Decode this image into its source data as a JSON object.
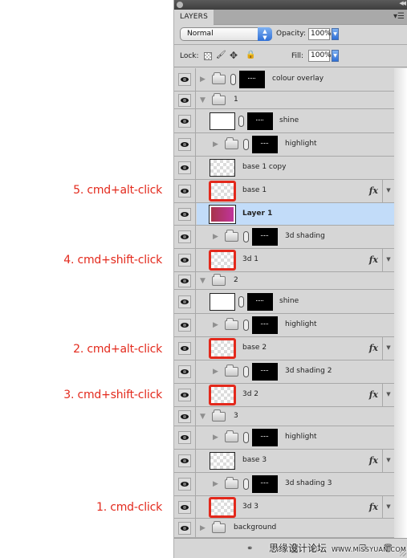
{
  "annotations": [
    {
      "label": "5. cmd+alt-click",
      "target": "base 1"
    },
    {
      "label": "4. cmd+shift-click",
      "target": "3d 1"
    },
    {
      "label": "2. cmd+alt-click",
      "target": "base 2"
    },
    {
      "label": "3. cmd+shift-click",
      "target": "3d 2"
    },
    {
      "label": "1. cmd-click",
      "target": "3d 3"
    }
  ],
  "panel": {
    "tab_label": "LAYERS",
    "collapse_icon": "double-arrow-icon",
    "menu_icon": "panel-menu-icon",
    "blend_mode": "Normal",
    "opacity_label": "Opacity:",
    "opacity_value": "100%",
    "lock_label": "Lock:",
    "fill_label": "Fill:",
    "fill_value": "100%",
    "lock_icons": [
      "lock-transparency-icon",
      "lock-paint-icon",
      "lock-move-icon",
      "lock-all-icon"
    ]
  },
  "layers": [
    {
      "name": "colour overlay",
      "type": "group",
      "expanded": false,
      "mask": true,
      "indent": 0
    },
    {
      "name": "1",
      "type": "group",
      "expanded": true,
      "mask": false,
      "indent": 0
    },
    {
      "name": "shine",
      "type": "layer",
      "mask": true,
      "indent": 1
    },
    {
      "name": "highlight",
      "type": "group",
      "expanded": false,
      "mask": true,
      "indent": 1
    },
    {
      "name": "base 1 copy",
      "type": "layer",
      "indent": 1
    },
    {
      "name": "base 1",
      "type": "layer",
      "indent": 1,
      "fx": true,
      "highlighted_thumb": true
    },
    {
      "name": "Layer 1",
      "type": "layer",
      "indent": 1,
      "selected": true
    },
    {
      "name": "3d shading",
      "type": "group",
      "expanded": false,
      "mask": true,
      "indent": 1
    },
    {
      "name": "3d 1",
      "type": "layer",
      "indent": 1,
      "fx": true,
      "highlighted_thumb": true
    },
    {
      "name": "2",
      "type": "group",
      "expanded": true,
      "mask": false,
      "indent": 0
    },
    {
      "name": "shine",
      "type": "layer",
      "mask": true,
      "indent": 1
    },
    {
      "name": "highlight",
      "type": "group",
      "expanded": false,
      "mask": true,
      "indent": 1
    },
    {
      "name": "base 2",
      "type": "layer",
      "indent": 1,
      "fx": true,
      "highlighted_thumb": true
    },
    {
      "name": "3d shading 2",
      "type": "group",
      "expanded": false,
      "mask": true,
      "indent": 1
    },
    {
      "name": "3d 2",
      "type": "layer",
      "indent": 1,
      "fx": true,
      "highlighted_thumb": true
    },
    {
      "name": "3",
      "type": "group",
      "expanded": true,
      "mask": false,
      "indent": 0
    },
    {
      "name": "highlight",
      "type": "group",
      "expanded": false,
      "mask": true,
      "indent": 1
    },
    {
      "name": "base 3",
      "type": "layer",
      "indent": 1,
      "fx": true
    },
    {
      "name": "3d shading 3",
      "type": "group",
      "expanded": false,
      "mask": true,
      "indent": 1
    },
    {
      "name": "3d 3",
      "type": "layer",
      "indent": 1,
      "fx": true,
      "highlighted_thumb": true
    },
    {
      "name": "background",
      "type": "group",
      "expanded": false,
      "mask": false,
      "indent": 0
    }
  ],
  "footer": {
    "icons": [
      "link-layers-icon",
      "fx-icon",
      "add-mask-icon",
      "adjustment-layer-icon",
      "new-group-icon",
      "new-layer-icon",
      "trash-icon"
    ],
    "watermark": "思缘设计论坛",
    "watermark_url": "WWW.MISSYUAN.COM"
  },
  "colors": {
    "annotation": "#e3291c",
    "selected_row": "#c2dcf9",
    "panel_bg": "#d6d6d6"
  }
}
